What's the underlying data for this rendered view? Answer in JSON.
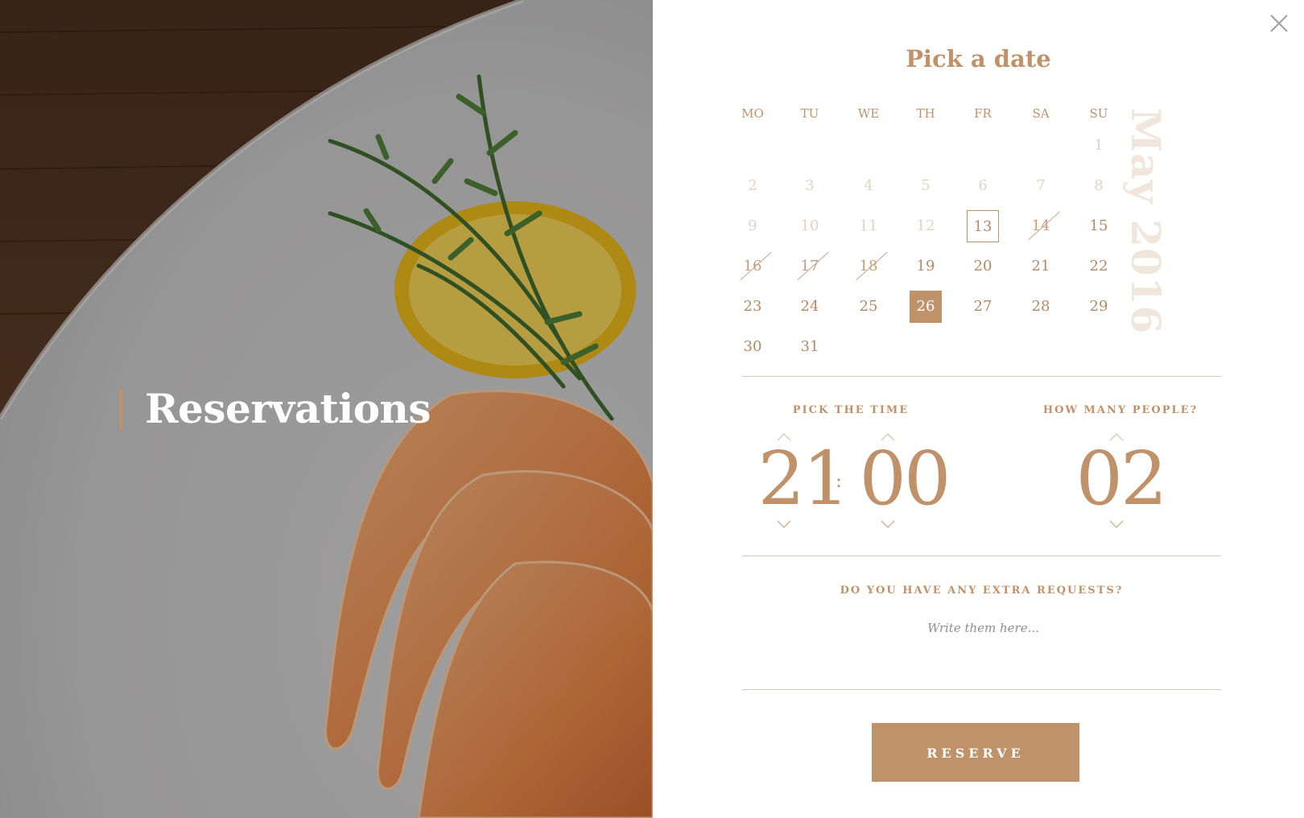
{
  "hero": {
    "title": "Reservations"
  },
  "calendar": {
    "heading": "Pick a date",
    "month_label": "May 2016",
    "weekdays": [
      "MO",
      "TU",
      "WE",
      "TH",
      "FR",
      "SA",
      "SU"
    ],
    "days": [
      "1",
      "2",
      "3",
      "4",
      "5",
      "6",
      "7",
      "8",
      "9",
      "10",
      "11",
      "12",
      "13",
      "14",
      "15",
      "16",
      "17",
      "18",
      "19",
      "20",
      "21",
      "22",
      "23",
      "24",
      "25",
      "26",
      "27",
      "28",
      "29",
      "30",
      "31"
    ],
    "past_days": [
      1,
      2,
      3,
      4,
      5,
      6,
      7,
      8,
      9,
      10,
      11,
      12
    ],
    "today": 13,
    "unavailable_days": [
      14,
      16,
      17,
      18
    ],
    "selected": 26
  },
  "time": {
    "label": "PICK THE TIME",
    "hour": "21",
    "separator": ":",
    "minute": "00"
  },
  "people": {
    "label": "HOW MANY PEOPLE?",
    "count": "02"
  },
  "requests": {
    "label": "DO YOU HAVE ANY EXTRA REQUESTS?",
    "placeholder": "Write them here...",
    "value": ""
  },
  "actions": {
    "reserve_label": "RESERVE"
  },
  "colors": {
    "accent": "#c0926a",
    "accent_light": "#f1e6dc",
    "past_day": "#e4d2c3"
  },
  "icons": {
    "close": "close-icon",
    "up": "chevron-up-icon",
    "down": "chevron-down-icon"
  }
}
